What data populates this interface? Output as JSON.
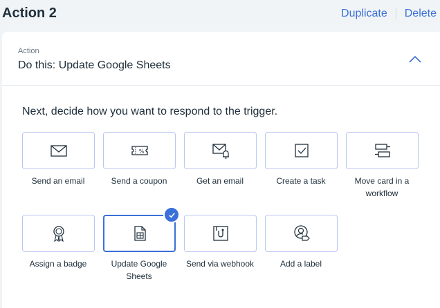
{
  "header": {
    "title": "Action 2",
    "duplicate_label": "Duplicate",
    "delete_label": "Delete"
  },
  "section": {
    "label": "Action",
    "value": "Do this: Update Google Sheets"
  },
  "prompt": "Next, decide how you want to respond to the trigger.",
  "actions": [
    {
      "label": "Send an email",
      "icon": "envelope-icon"
    },
    {
      "label": "Send a coupon",
      "icon": "coupon-icon"
    },
    {
      "label": "Get an email",
      "icon": "envelope-bell-icon"
    },
    {
      "label": "Create a task",
      "icon": "checkbox-icon"
    },
    {
      "label": "Move card in a workflow",
      "icon": "workflow-cards-icon"
    },
    {
      "label": "Assign a badge",
      "icon": "badge-icon"
    },
    {
      "label": "Update Google Sheets",
      "icon": "spreadsheet-icon",
      "selected": true
    },
    {
      "label": "Send via webhook",
      "icon": "webhook-icon"
    },
    {
      "label": "Add a label",
      "icon": "user-label-icon"
    }
  ],
  "colors": {
    "accent": "#3b6fd9",
    "tile_border": "#b9c7f2",
    "background": "#f0f4f7"
  }
}
